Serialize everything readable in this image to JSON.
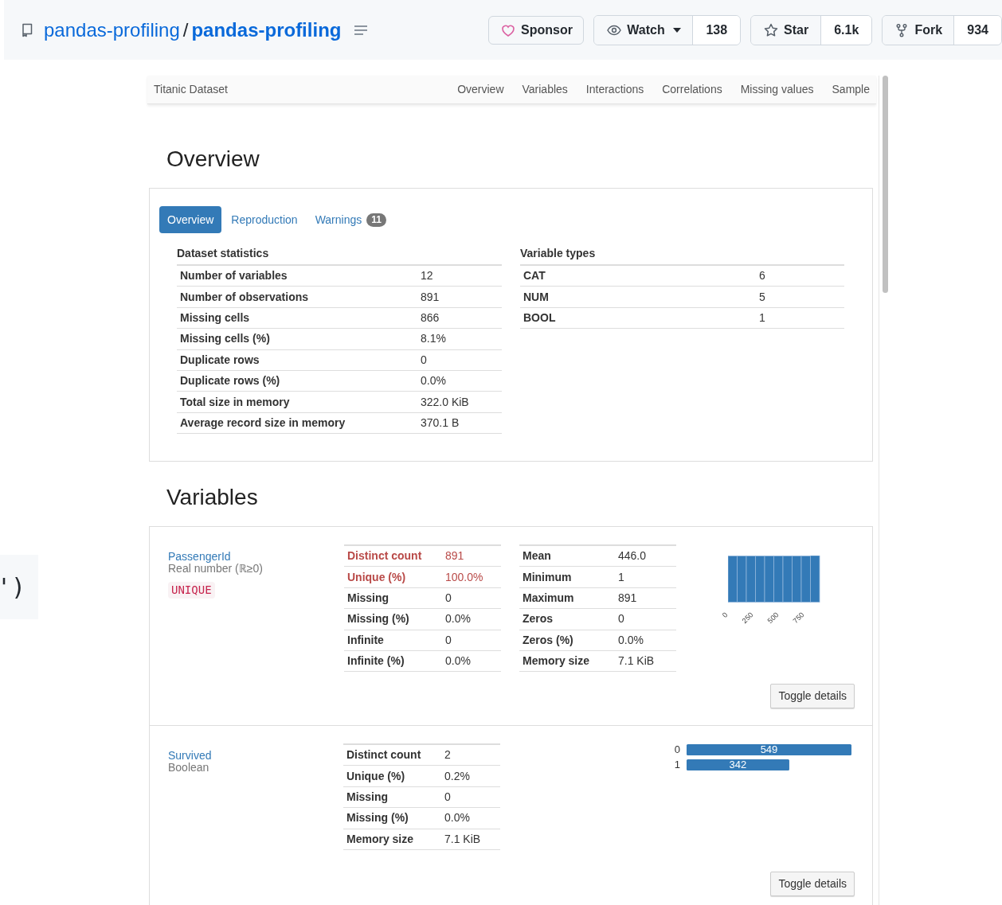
{
  "repo": {
    "owner": "pandas-profiling",
    "separator": "/",
    "name": "pandas-profiling"
  },
  "actions": [
    {
      "kind": "sponsor",
      "label": "Sponsor"
    },
    {
      "kind": "watch",
      "label": "Watch",
      "count": "138"
    },
    {
      "kind": "star",
      "label": "Star",
      "count": "6.1k"
    },
    {
      "kind": "fork",
      "label": "Fork",
      "count": "934"
    }
  ],
  "side_fragment": {
    "text": "')"
  },
  "report": {
    "nav": {
      "brand": "Titanic Dataset",
      "links": [
        "Overview",
        "Variables",
        "Interactions",
        "Correlations",
        "Missing values",
        "Sample"
      ]
    },
    "overview": {
      "title": "Overview",
      "tabs": [
        {
          "label": "Overview",
          "selected": true
        },
        {
          "label": "Reproduction",
          "selected": false
        },
        {
          "label": "Warnings",
          "selected": false,
          "badge": "11"
        }
      ],
      "dataset_statistics": {
        "title": "Dataset statistics",
        "rows": [
          {
            "label": "Number of variables",
            "value": "12"
          },
          {
            "label": "Number of observations",
            "value": "891"
          },
          {
            "label": "Missing cells",
            "value": "866"
          },
          {
            "label": "Missing cells (%)",
            "value": "8.1%"
          },
          {
            "label": "Duplicate rows",
            "value": "0"
          },
          {
            "label": "Duplicate rows (%)",
            "value": "0.0%"
          },
          {
            "label": "Total size in memory",
            "value": "322.0 KiB"
          },
          {
            "label": "Average record size in memory",
            "value": "370.1 B"
          }
        ]
      },
      "variable_types": {
        "title": "Variable types",
        "rows": [
          {
            "label": "CAT",
            "value": "6"
          },
          {
            "label": "NUM",
            "value": "5"
          },
          {
            "label": "BOOL",
            "value": "1"
          }
        ]
      }
    },
    "variables": {
      "title": "Variables",
      "items": [
        {
          "name": "PassengerId",
          "type": "Real number (ℝ≥0)",
          "badge": "UNIQUE",
          "stats": [
            {
              "label": "Distinct count",
              "value": "891",
              "alert": true
            },
            {
              "label": "Unique (%)",
              "value": "100.0%",
              "alert": true
            },
            {
              "label": "Missing",
              "value": "0",
              "alert": false
            },
            {
              "label": "Missing (%)",
              "value": "0.0%",
              "alert": false
            },
            {
              "label": "Infinite",
              "value": "0",
              "alert": false
            },
            {
              "label": "Infinite (%)",
              "value": "0.0%",
              "alert": false
            }
          ],
          "stats_2": [
            {
              "label": "Mean",
              "value": "446.0"
            },
            {
              "label": "Minimum",
              "value": "1"
            },
            {
              "label": "Maximum",
              "value": "891"
            },
            {
              "label": "Zeros",
              "value": "0"
            },
            {
              "label": "Zeros (%)",
              "value": "0.0%"
            },
            {
              "label": "Memory size",
              "value": "7.1 KiB"
            }
          ],
          "chart": {
            "kind": "histogram",
            "tick_labels": [
              "0",
              "250",
              "500",
              "750"
            ]
          },
          "button": "Toggle details"
        },
        {
          "name": "Survived",
          "type": "Boolean",
          "stats": [
            {
              "label": "Distinct count",
              "value": "2",
              "alert": false
            },
            {
              "label": "Unique (%)",
              "value": "0.2%",
              "alert": false
            },
            {
              "label": "Missing",
              "value": "0",
              "alert": false
            },
            {
              "label": "Missing (%)",
              "value": "0.0%",
              "alert": false
            },
            {
              "label": "Memory size",
              "value": "7.1 KiB",
              "alert": false
            }
          ],
          "chart": {
            "kind": "bars",
            "chart_data": {
              "type": "bar",
              "orientation": "horizontal",
              "categories": [
                "0",
                "1"
              ],
              "series": [
                {
                  "color": "#337ab7",
                  "values": [
                    549,
                    342
                  ]
                }
              ],
              "data_labels": true
            }
          },
          "button": "Toggle details"
        }
      ]
    }
  }
}
